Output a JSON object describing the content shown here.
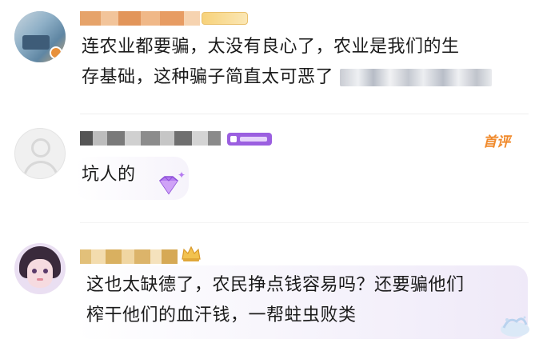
{
  "comments": [
    {
      "text": "连农业都要骗，太没有良心了，农业是我们的生存基础，这种骗子简直太可恶了",
      "line1": "连农业都要骗，太没有良心了，农业是我们的生",
      "line2": "存基础，这种骗子简直太可恶了",
      "username_color": "#e8913b"
    },
    {
      "text": "坑人的",
      "tag": "首评",
      "username_color": "#555555",
      "badge_color": "#9b5fe0"
    },
    {
      "text": "这也太缺德了，农民挣点钱容易吗？还要骗他们榨干他们的血汗钱，一帮蛀虫败类",
      "line1": "这也太缺德了，农民挣点钱容易吗？还要骗他们",
      "line2": "榨干他们的血汗钱，一帮蛀虫败类",
      "username_color": "#d9a84a"
    }
  ],
  "colors": {
    "accent_orange": "#f08a2c",
    "vip_purple": "#9b5fe0",
    "bubble_bg": "#f7f5fb"
  }
}
